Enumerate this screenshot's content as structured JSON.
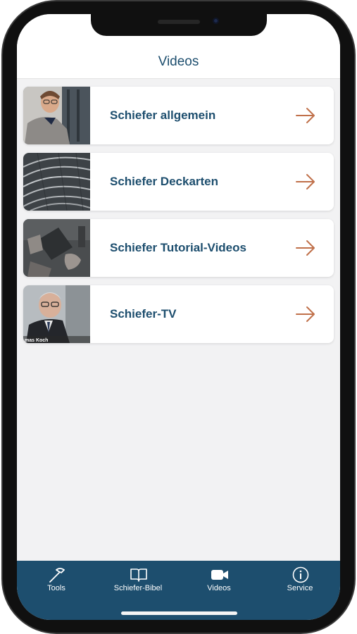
{
  "header": {
    "title": "Videos"
  },
  "items": [
    {
      "label": "Schiefer allgemein",
      "thumb_icon": "man-portrait-photo"
    },
    {
      "label": "Schiefer Deckarten",
      "thumb_icon": "slate-roof-photo"
    },
    {
      "label": "Schiefer Tutorial-Videos",
      "thumb_icon": "slate-tools-photo"
    },
    {
      "label": "Schiefer-TV",
      "thumb_icon": "man-with-glasses-photo",
      "caption": "mas Koch"
    }
  ],
  "tabs": [
    {
      "label": "Tools",
      "icon": "hammer-icon"
    },
    {
      "label": "Schiefer-Bibel",
      "icon": "book-icon"
    },
    {
      "label": "Videos",
      "icon": "video-camera-icon",
      "active": true
    },
    {
      "label": "Service",
      "icon": "info-icon"
    }
  ],
  "colors": {
    "primary": "#1d4e6e",
    "accent": "#c0704a",
    "background": "#f2f2f3"
  }
}
